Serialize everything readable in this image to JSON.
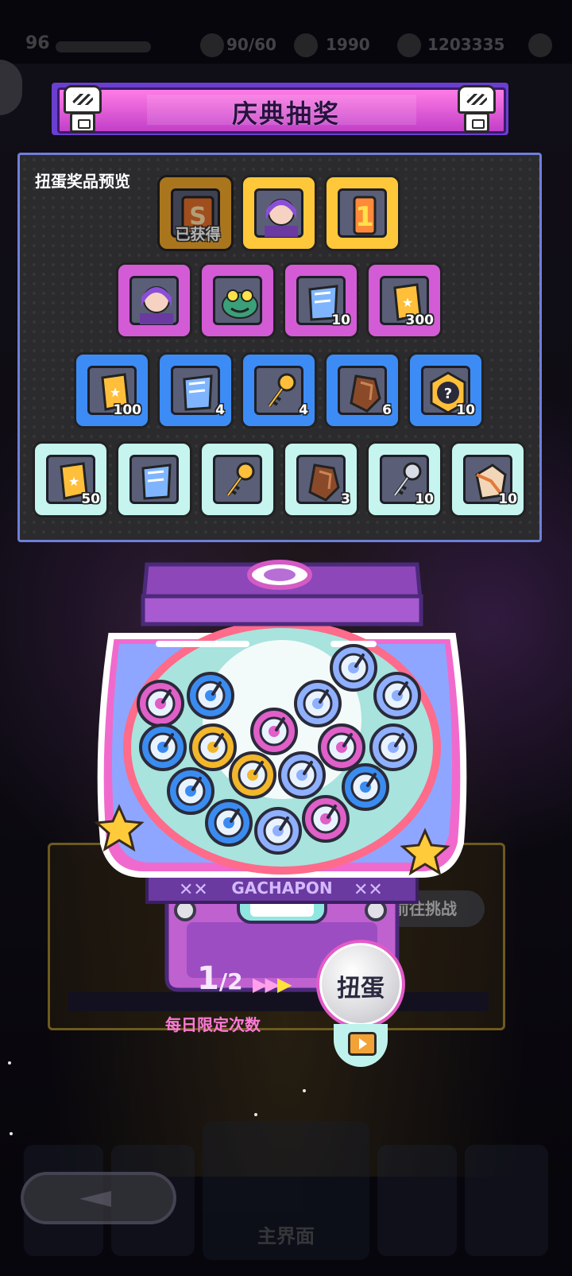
{
  "topbar": {
    "level": "96",
    "energy": "90/60",
    "gems": "1990",
    "coins": "1203335"
  },
  "banner": {
    "title": "庆典抽奖"
  },
  "prize_preview": {
    "label": "扭蛋奖品预览",
    "rows": [
      [
        {
          "tier": "orange",
          "icon": "s-rank-card-icon",
          "qty": "",
          "owned": "已获得"
        },
        {
          "tier": "gold",
          "icon": "character-portrait-icon",
          "qty": ""
        },
        {
          "tier": "gold",
          "icon": "number-one-badge-icon",
          "qty": ""
        }
      ],
      [
        {
          "tier": "purple",
          "icon": "character-portrait-icon",
          "qty": ""
        },
        {
          "tier": "purple",
          "icon": "frog-character-icon",
          "qty": ""
        },
        {
          "tier": "purple",
          "icon": "blue-ticket-icon",
          "qty": "10"
        },
        {
          "tier": "purple",
          "icon": "gold-ticket-icon",
          "qty": "300"
        }
      ],
      [
        {
          "tier": "blue",
          "icon": "gold-ticket-icon",
          "qty": "100"
        },
        {
          "tier": "blue",
          "icon": "blue-ticket-icon",
          "qty": "4"
        },
        {
          "tier": "blue",
          "icon": "gold-key-icon",
          "qty": "4"
        },
        {
          "tier": "blue",
          "icon": "brown-crystal-icon",
          "qty": "6"
        },
        {
          "tier": "blue",
          "icon": "mystery-box-icon",
          "qty": "10"
        }
      ],
      [
        {
          "tier": "cyan",
          "icon": "gold-ticket-icon",
          "qty": "50"
        },
        {
          "tier": "cyan",
          "icon": "blue-ticket-icon",
          "qty": ""
        },
        {
          "tier": "cyan",
          "icon": "gold-key-icon",
          "qty": ""
        },
        {
          "tier": "cyan",
          "icon": "brown-crystal-icon",
          "qty": "3"
        },
        {
          "tier": "cyan",
          "icon": "silver-key-icon",
          "qty": "10"
        },
        {
          "tier": "cyan",
          "icon": "ore-chunk-icon",
          "qty": "10"
        }
      ]
    ]
  },
  "machine": {
    "label": "GACHAPON",
    "spins_used": "1",
    "spins_total": "/2",
    "daily_note": "每日限定次数",
    "spin_button": "扭蛋"
  },
  "background": {
    "challenge_button": "前往挑战",
    "home_label": "主界面"
  },
  "colors": {
    "banner_pink": "#ff7ce6",
    "panel_border": "#6f7fd8",
    "tier_gold": "#ffc83a",
    "tier_purple": "#d35bd6",
    "tier_blue": "#3d8cf5",
    "tier_cyan": "#c6f4ef"
  }
}
